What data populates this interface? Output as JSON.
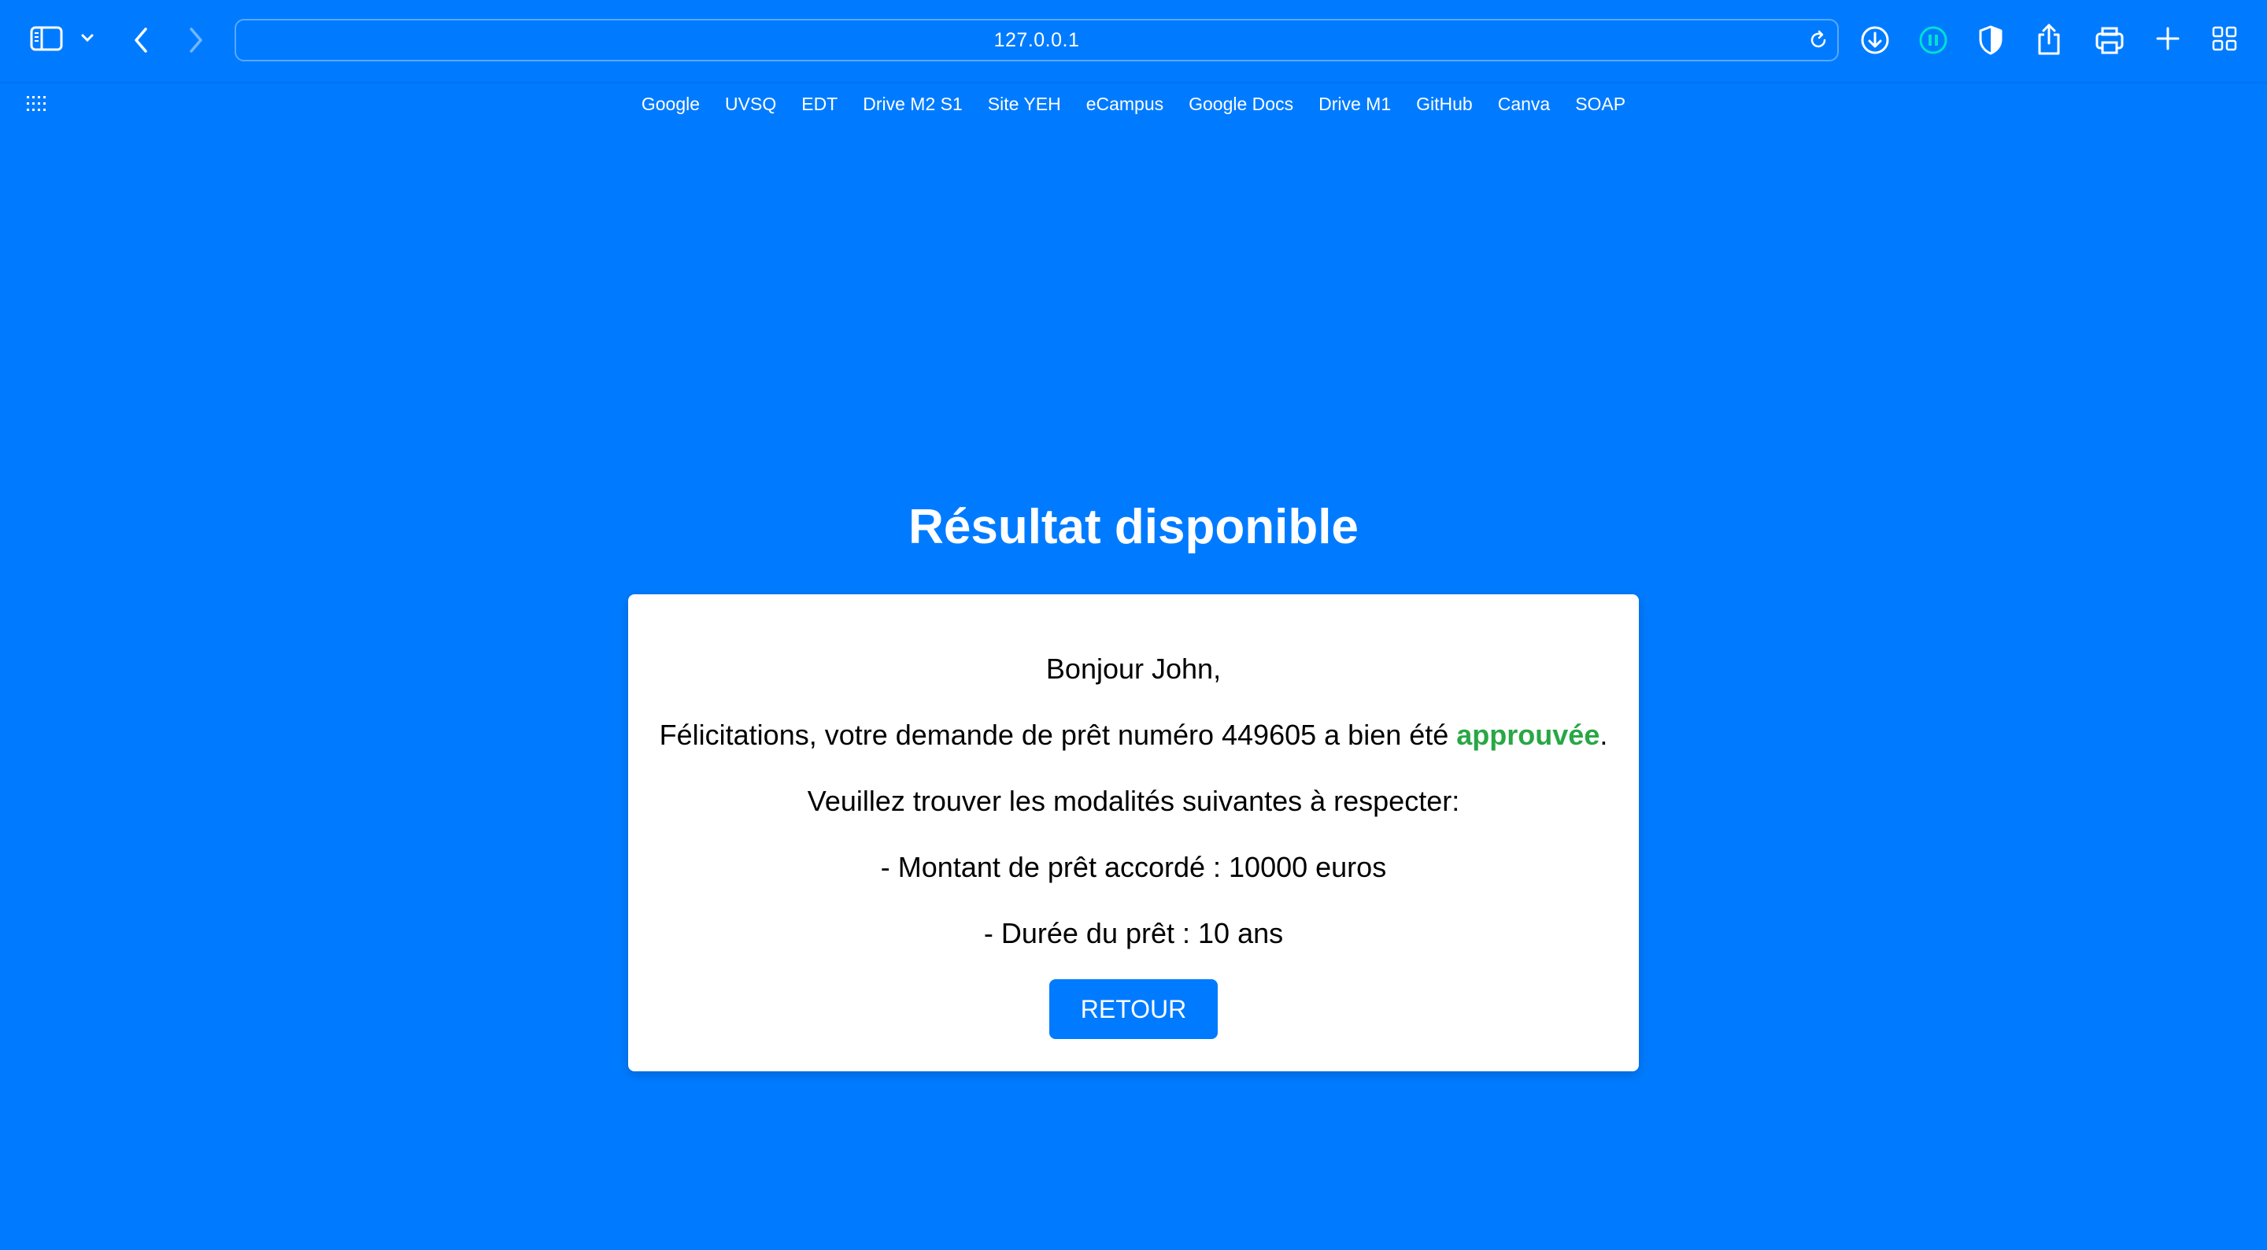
{
  "browser": {
    "address": "127.0.0.1",
    "bookmarks": [
      "Google",
      "UVSQ",
      "EDT",
      "Drive M2 S1",
      "Site YEH",
      "eCampus",
      "Google Docs",
      "Drive M1",
      "GitHub",
      "Canva",
      "SOAP"
    ]
  },
  "page": {
    "title": "Résultat disponible",
    "greeting": "Bonjour John,",
    "message_prefix": "Félicitations, votre demande de prêt numéro 449605 a bien été ",
    "status": "approuvée",
    "message_suffix": ".",
    "terms_intro": "Veuillez trouver les modalités suivantes à respecter:",
    "amount_line": "- Montant de prêt accordé : 10000 euros",
    "duration_line": "- Durée du prêt : 10 ans",
    "button_label": "RETOUR"
  },
  "colors": {
    "background": "#007bff",
    "approved": "#28a745",
    "card": "#ffffff"
  },
  "icons": {
    "toolbar": [
      "sidebar-icon",
      "chevron-down-icon",
      "back-icon",
      "forward-icon",
      "reload-icon",
      "download-icon",
      "pause-icon",
      "shield-icon",
      "share-icon",
      "print-icon",
      "plus-icon",
      "tab-grid-icon"
    ],
    "bookmarks": "apps-grid-icon"
  }
}
